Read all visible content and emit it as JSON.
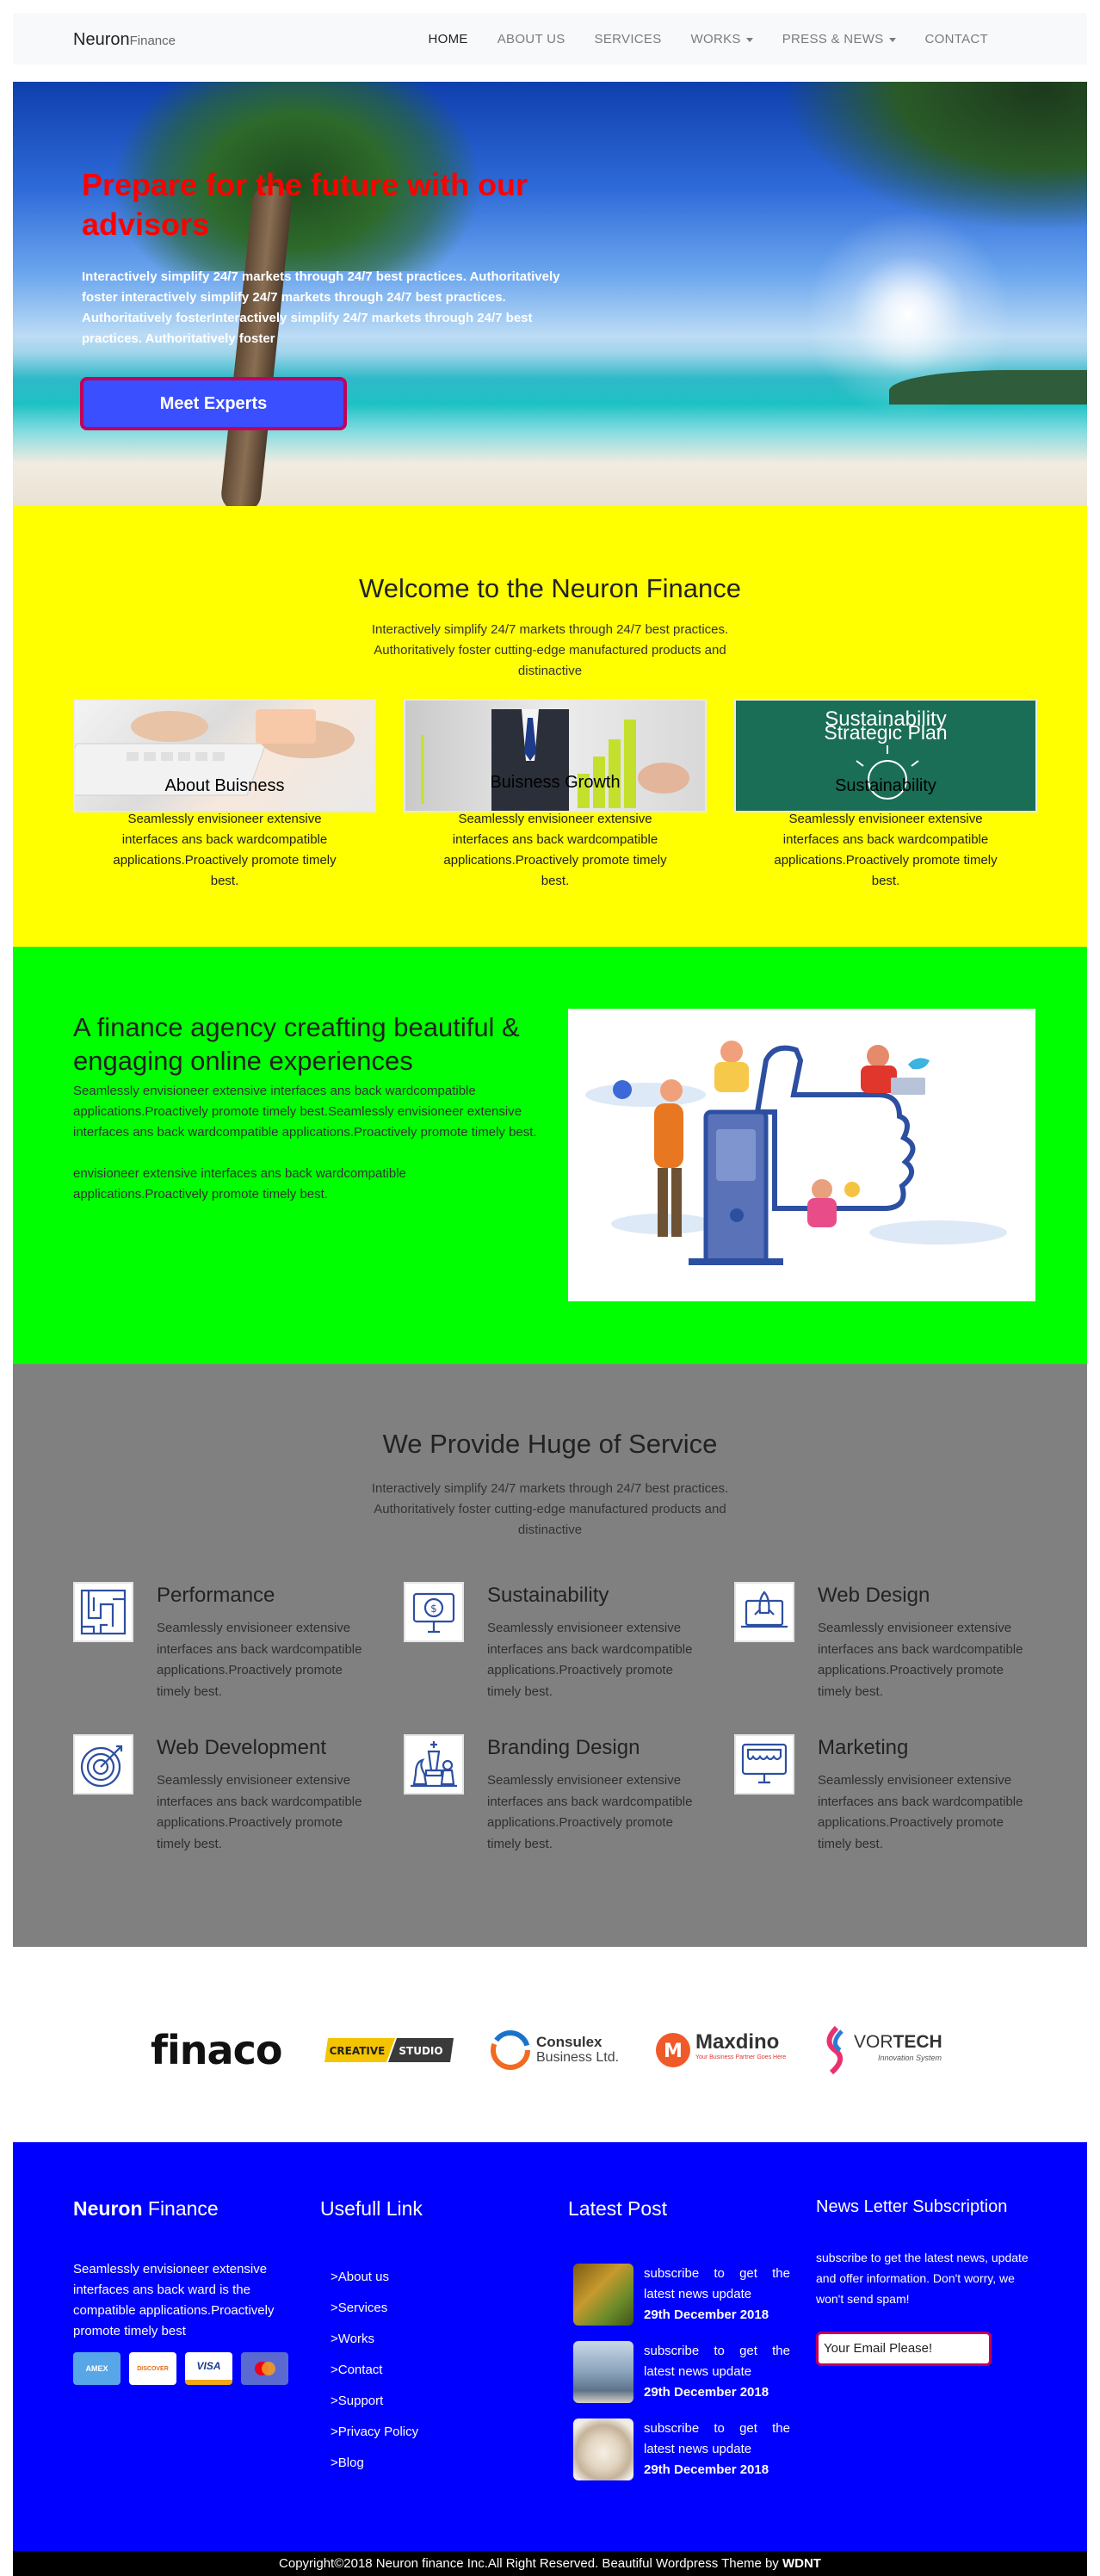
{
  "nav": {
    "brand_main": "Neuron",
    "brand_sub": "Finance",
    "items": [
      "HOME",
      "ABOUT US",
      "SERVICES",
      "WORKS",
      "PRESS & NEWS",
      "CONTACT"
    ]
  },
  "hero": {
    "title": "Prepare for the future with our advisors",
    "text": "Interactively simplify 24/7 markets through 24/7 best practices. Authoritatively foster interactively simplify 24/7 markets through 24/7 best practices. Authoritatively fosterInteractively simplify 24/7 markets through 24/7 best practices. Authoritatively foster",
    "button": "Meet Experts"
  },
  "welcome": {
    "title": "Welcome to the Neuron Finance",
    "subtitle": "Interactively simplify 24/7 markets through 24/7 best practices. Authoritatively foster cutting-edge manufactured products and distinactive",
    "cards": [
      {
        "label": "About Buisness",
        "text": "Seamlessly envisioneer extensive interfaces ans back wardcompatible applications.Proactively promote timely best."
      },
      {
        "label": "Buisness Growth",
        "text": "Seamlessly envisioneer extensive interfaces ans back wardcompatible applications.Proactively promote timely best."
      },
      {
        "label": "Sustainability",
        "overlay_top": "Sustainability",
        "overlay_sub": "Strategic Plan",
        "text": "Seamlessly envisioneer extensive interfaces ans back wardcompatible applications.Proactively promote timely best."
      }
    ]
  },
  "agency": {
    "title": "A finance agency creafting beautiful & engaging online experiences",
    "para1": "Seamlessly envisioneer extensive interfaces ans back wardcompatible applications.Proactively promote timely best.Seamlessly envisioneer extensive interfaces ans back wardcompatible applications.Proactively promote timely best.",
    "para2": "envisioneer extensive interfaces ans back wardcompatible applications.Proactively promote timely best."
  },
  "services": {
    "title": "We Provide Huge of Service",
    "subtitle": "Interactively simplify 24/7 markets through 24/7 best practices. Authoritatively foster cutting-edge manufactured products and distinactive",
    "items": [
      {
        "title": "Performance",
        "icon": "maze-icon",
        "text": "Seamlessly envisioneer extensive interfaces ans back wardcompatible applications.Proactively promote timely best."
      },
      {
        "title": "Sustainability",
        "icon": "dollar-monitor-icon",
        "text": "Seamlessly envisioneer extensive interfaces ans back wardcompatible applications.Proactively promote timely best."
      },
      {
        "title": "Web Design",
        "icon": "rocket-laptop-icon",
        "text": "Seamlessly envisioneer extensive interfaces ans back wardcompatible applications.Proactively promote timely best."
      },
      {
        "title": "Web Development",
        "icon": "target-icon",
        "text": "Seamlessly envisioneer extensive interfaces ans back wardcompatible applications.Proactively promote timely best."
      },
      {
        "title": "Branding Design",
        "icon": "chess-icon",
        "text": "Seamlessly envisioneer extensive interfaces ans back wardcompatible applications.Proactively promote timely best."
      },
      {
        "title": "Marketing",
        "icon": "storefront-icon",
        "text": "Seamlessly envisioneer extensive interfaces ans back wardcompatible applications.Proactively promote timely best."
      }
    ]
  },
  "partners": {
    "finaco": "finaco",
    "creative_a": "CREATIVE",
    "creative_b": "STUDIO",
    "consulex_a": "Consulex",
    "consulex_b": "Business Ltd.",
    "maxdino": "Maxdino",
    "maxdino_tag": "Your Business Partner Goes Here",
    "vortech_a": "VOR",
    "vortech_b": "TECH",
    "vortech_tag": "Innovation System"
  },
  "footer": {
    "brand_main": "Neuron",
    "brand_sub": " Finance",
    "about": "Seamlessly envisioneer extensive interfaces ans back ward is the compatible applications.Proactively promote timely best",
    "payments": [
      "AMEX",
      "DISCOVER",
      "VISA",
      "mastercard"
    ],
    "links_title": "Usefull Link",
    "links": [
      ">About us",
      ">Services",
      ">Works",
      ">Contact",
      ">Support",
      ">Privacy Policy",
      ">Blog"
    ],
    "posts_title": "Latest Post",
    "posts": [
      {
        "text": "subscribe to get the latest news update",
        "date": "29th December 2018"
      },
      {
        "text": "subscribe to get the latest news update",
        "date": "29th December 2018"
      },
      {
        "text": "subscribe to get the latest news update",
        "date": "29th December 2018"
      }
    ],
    "newsletter_title": "News Letter Subscription",
    "newsletter_text": "subscribe to get the latest news, update and offer information. Don't worry, we won't send spam!",
    "email_placeholder": "Your Email Please!"
  },
  "copyright": {
    "text": "Copyright©2018 Neuron finance Inc.All Right Reserved. Beautiful Wordpress Theme by ",
    "author": "WDNT"
  }
}
